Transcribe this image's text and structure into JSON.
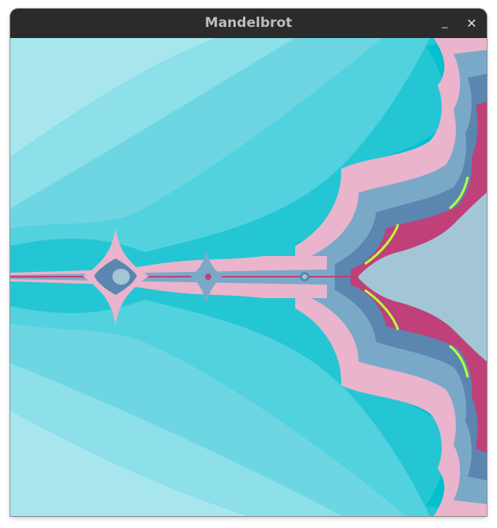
{
  "window": {
    "title": "Mandelbrot",
    "minimize_icon": "minimize-icon",
    "close_icon": "close-icon",
    "minimize_glyph": "_",
    "close_glyph": "✕"
  },
  "colors": {
    "titlebar": "#2b2b2b",
    "title_text": "#bdbdbd",
    "band_outer": "#a8e6ee",
    "band_2": "#8ddfe9",
    "band_3": "#6dd6e2",
    "band_4": "#4fcfdc",
    "band_5": "#25c6d4",
    "band_6": "#00bfcf",
    "pink": "#eab4cc",
    "pink_dark": "#d98fb2",
    "blue_mid": "#7aa9c8",
    "blue_dark": "#5a86b0",
    "interior": "#a3c6d7",
    "magenta": "#c0407a",
    "lime": "#b7ff3a"
  }
}
